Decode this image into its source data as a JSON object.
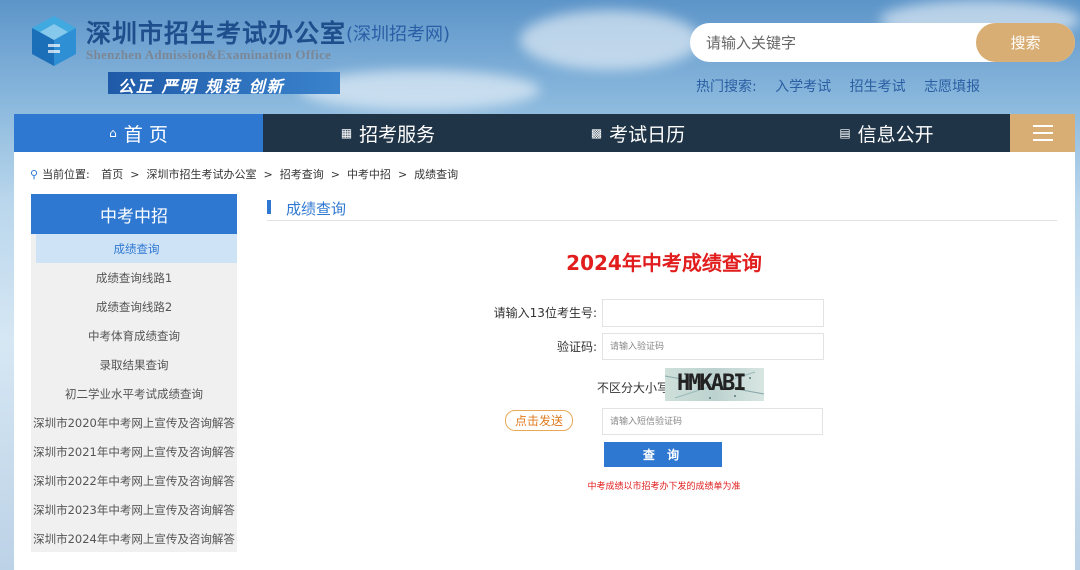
{
  "header": {
    "site_name": "深圳市招生考试办公室",
    "site_subtitle": "(深圳招考网)",
    "site_name_en": "Shenzhen Admission&Examination Office",
    "slogan": "公正 严明 规范 创新"
  },
  "search": {
    "placeholder": "请输入关键字",
    "button_label": "搜索",
    "hot_label": "热门搜索:",
    "hot_items": [
      "入学考试",
      "招生考试",
      "志愿填报"
    ]
  },
  "nav": {
    "items": [
      {
        "label": "首 页",
        "icon": "home-icon"
      },
      {
        "label": "招考服务",
        "icon": "grid-icon"
      },
      {
        "label": "考试日历",
        "icon": "calendar-icon"
      },
      {
        "label": "信息公开",
        "icon": "document-icon"
      }
    ],
    "menu_icon": "hamburger-menu-icon"
  },
  "breadcrumb": {
    "prefix": "当前位置:",
    "items": [
      "首页",
      "深圳市招生考试办公室",
      "招考查询",
      "中考中招",
      "成绩查询"
    ],
    "separator": ">"
  },
  "sidebar": {
    "title": "中考中招",
    "items": [
      {
        "label": "成绩查询",
        "active": true
      },
      {
        "label": "成绩查询线路1"
      },
      {
        "label": "成绩查询线路2"
      },
      {
        "label": "中考体育成绩查询"
      },
      {
        "label": "录取结果查询"
      },
      {
        "label": "初二学业水平考试成绩查询"
      },
      {
        "label": "深圳市2020年中考网上宣传及咨询解答"
      },
      {
        "label": "深圳市2021年中考网上宣传及咨询解答"
      },
      {
        "label": "深圳市2022年中考网上宣传及咨询解答"
      },
      {
        "label": "深圳市2023年中考网上宣传及咨询解答"
      },
      {
        "label": "深圳市2024年中考网上宣传及咨询解答"
      }
    ]
  },
  "main": {
    "section_title": "成绩查询",
    "form_title": "2024年中考成绩查询",
    "exam_no_label": "请输入13位考生号:",
    "exam_no_value": "",
    "captcha_label": "验证码:",
    "captcha_placeholder": "请输入验证码",
    "case_hint": "不区分大小写",
    "captcha_text": "HMKABI",
    "send_button": "点击发送",
    "sms_placeholder": "请输入短信验证码",
    "query_button": "查 询",
    "note": "中考成绩以市招考办下发的成绩单为准"
  },
  "colors": {
    "primary": "#2f78d1",
    "nav_dark": "#1f3447",
    "accent_gold": "#d9ae74",
    "title_red": "#e11d1d"
  }
}
